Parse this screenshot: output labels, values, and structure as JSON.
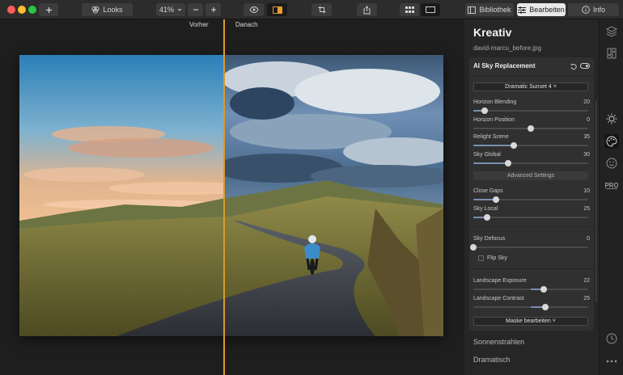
{
  "toolbar": {
    "looks_label": "Looks",
    "zoom_value": "41%",
    "bibliothek_label": "Bibliothek",
    "bearbeiten_label": "Bearbeiten",
    "info_label": "Info"
  },
  "canvas": {
    "before_label": "Vorher",
    "after_label": "Danach"
  },
  "panel": {
    "title": "Kreativ",
    "filename": "david-marcu_before.jpg",
    "filter": {
      "title": "AI Sky Replacement",
      "preset": "Dramatic Sunset 4",
      "advanced_label": "Advanced Settings",
      "mask_label": "Maske bearbeiten",
      "flip_sky_label": "Flip Sky",
      "sliders": [
        {
          "label": "Horizon Blending",
          "value": "20",
          "level": 0.1
        },
        {
          "label": "Horizon Position",
          "value": "0",
          "level": 0.5,
          "bipolar": true
        },
        {
          "label": "Relight Scene",
          "value": "35",
          "level": 0.35
        },
        {
          "label": "Sky Global",
          "value": "30",
          "level": 0.3
        },
        {
          "label": "Close Gaps",
          "value": "10",
          "level": 0.2
        },
        {
          "label": "Sky Local",
          "value": "25",
          "level": 0.12
        },
        {
          "label": "Sky Defocus",
          "value": "0",
          "level": 0.0
        },
        {
          "label": "Landscape Exposure",
          "value": "22",
          "level": 0.61,
          "bipolar": true
        },
        {
          "label": "Landscape Contrast",
          "value": "25",
          "level": 0.625,
          "bipolar": true
        }
      ]
    },
    "list": [
      "Sonnenstrahlen",
      "Dramatisch"
    ]
  },
  "colors": {
    "accent_line": "#d99a2b",
    "slider_fill": "#7a8fb0"
  }
}
